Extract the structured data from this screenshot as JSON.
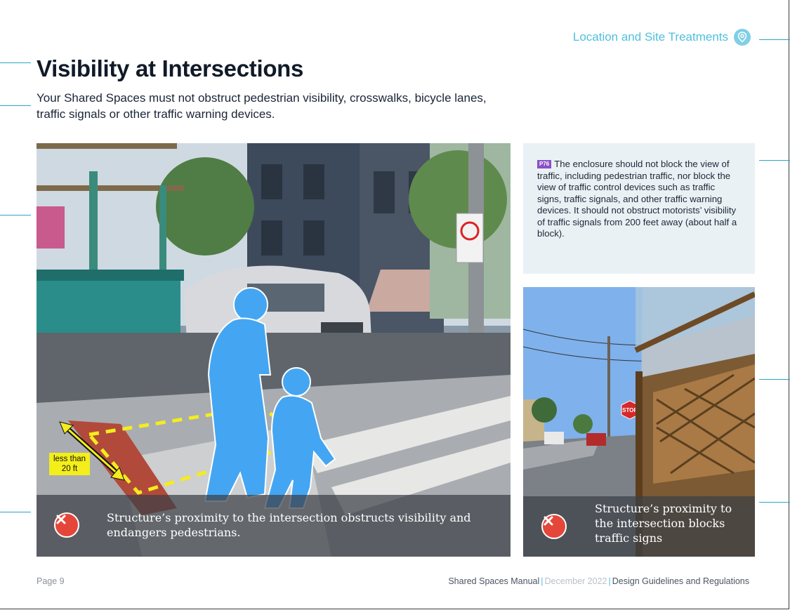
{
  "section": {
    "label": "Location and Site Treatments",
    "icon": "location-pin-icon"
  },
  "title": "Visibility at Intersections",
  "intro": "Your Shared Spaces must not obstruct pedestrian visibility, crosswalks, bicycle lanes, traffic signals or other traffic warning devices.",
  "info_box": {
    "badge": "P76",
    "text": "The enclosure should not block the view of traffic, including pedestrian traffic, nor block the view of traffic control devices such as traffic signs, traffic signals, and other traffic warning devices. It should not obstruct motorists’ visibility of traffic signals from 200 feet away (about half a block)."
  },
  "main_photo": {
    "distance_label": "less than 20 ft",
    "caption": "Structure’s proximity to the intersection obstructs visibility and endangers pedestrians."
  },
  "side_photo": {
    "stop_sign": "STOP",
    "caption": "Structure’s proximity to the intersection blocks traffic signs"
  },
  "footer": {
    "page": "Page 9",
    "manual": "Shared Spaces Manual",
    "date": "December 2022",
    "chapter": "Design Guidelines and Regulations"
  },
  "colors": {
    "accent": "#4fc0dd",
    "error": "#e5463a",
    "badge": "#8a4fc6",
    "info_bg": "#e9f1f4"
  }
}
